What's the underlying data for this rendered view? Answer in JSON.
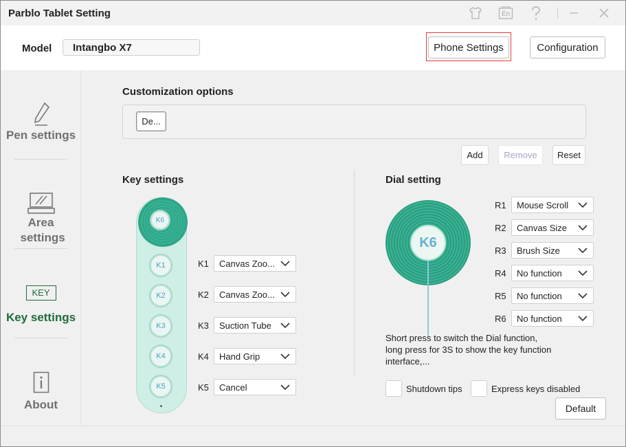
{
  "window": {
    "title": "Parblo Tablet Setting",
    "language_badge": "En"
  },
  "model": {
    "label": "Model",
    "value": "Intangbo X7"
  },
  "header": {
    "phone_settings_label": "Phone Settings",
    "configuration_label": "Configuration"
  },
  "sidebar": {
    "items": [
      {
        "label": "Pen settings"
      },
      {
        "label": "Area settings"
      },
      {
        "label": "Key settings",
        "badge": "KEY"
      },
      {
        "label": "About"
      }
    ]
  },
  "customization": {
    "title": "Customization options",
    "preset_label": "De...",
    "add_label": "Add",
    "remove_label": "Remove",
    "reset_label": "Reset"
  },
  "keys": {
    "title": "Key settings",
    "knob_label": "K6",
    "rows": [
      {
        "key": "K1",
        "value": "Canvas Zoo..."
      },
      {
        "key": "K2",
        "value": "Canvas Zoo..."
      },
      {
        "key": "K3",
        "value": "Suction Tube"
      },
      {
        "key": "K4",
        "value": "Hand Grip"
      },
      {
        "key": "K5",
        "value": "Cancel"
      }
    ]
  },
  "dial": {
    "title": "Dial setting",
    "center_label": "K6",
    "rows": [
      {
        "key": "R1",
        "value": "Mouse Scroll"
      },
      {
        "key": "R2",
        "value": "Canvas Size"
      },
      {
        "key": "R3",
        "value": "Brush Size"
      },
      {
        "key": "R4",
        "value": "No function"
      },
      {
        "key": "R5",
        "value": "No function"
      },
      {
        "key": "R6",
        "value": "No function"
      }
    ],
    "description_line1": "Short press to switch the Dial function,",
    "description_line2": "long press for 3S to show the key function",
    "description_line3": "interface,..."
  },
  "options": {
    "shutdown_tips_label": "Shutdown tips",
    "express_keys_disabled_label": "Express keys disabled",
    "default_label": "Default"
  },
  "colors": {
    "accent_green": "#1f6b3a",
    "dial_teal": "#2fa688",
    "highlight_red": "#e53935"
  }
}
